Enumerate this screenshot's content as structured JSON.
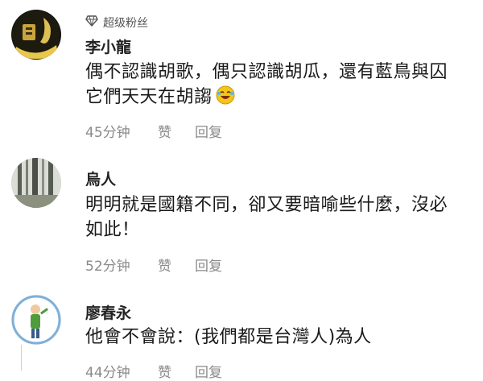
{
  "comments": [
    {
      "badge": "超级粉丝",
      "badge_icon": "diamond-icon",
      "username": "李小龍",
      "text_line1": "偶不認識胡歌，偶只認識胡瓜，還有藍鳥與囚",
      "text_line2": "它們天天在胡謅",
      "emoji": "laughing-face-emoji",
      "time": "45分钟",
      "like": "赞",
      "reply": "回复"
    },
    {
      "username": "烏人",
      "text_line1": "明明就是國籍不同，卻又要暗喻些什麼，沒必",
      "text_line2": "如此！",
      "time": "52分钟",
      "like": "赞",
      "reply": "回复"
    },
    {
      "username": "廖春永",
      "text_line1": "他會不會說：(我們都是台灣人)為人",
      "time": "44分钟",
      "like": "赞",
      "reply": "回复"
    }
  ],
  "colors": {
    "badge_diamond": "#555555",
    "emoji_face": "#f5c518",
    "meta_text": "#8a8a8a"
  }
}
